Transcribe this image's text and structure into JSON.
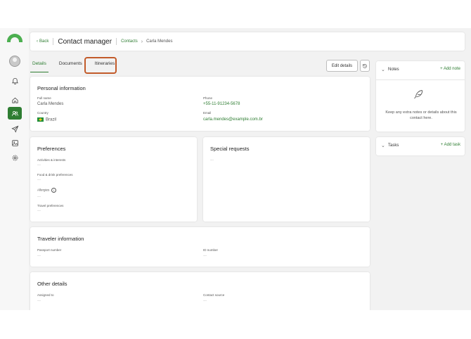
{
  "header": {
    "back_label": "Back",
    "title": "Contact manager",
    "breadcrumb_parent": "Contacts",
    "breadcrumb_current": "Carla Mendes"
  },
  "tabs": [
    {
      "label": "Details",
      "active": true
    },
    {
      "label": "Documents",
      "active": false
    },
    {
      "label": "Itineraries",
      "active": false
    }
  ],
  "toolbar": {
    "edit_label": "Edit details"
  },
  "personal": {
    "title": "Personal information",
    "full_name_label": "Full name",
    "full_name_value": "Carla Mendes",
    "phone_label": "Phone",
    "phone_value": "+55-11-91234-5678",
    "country_label": "Country",
    "country_value": "Brazil",
    "email_label": "Email",
    "email_value": "carla.mendes@example.com.br"
  },
  "preferences": {
    "title": "Preferences",
    "activities_label": "Activities & interests",
    "food_label": "Food & drink preferences",
    "allergies_label": "Allergies",
    "travel_label": "Travel preferences",
    "empty": "---"
  },
  "special_requests": {
    "title": "Special requests",
    "empty": "---"
  },
  "traveler": {
    "title": "Traveler information",
    "passport_label": "Passport number",
    "id_label": "ID number",
    "empty": "---"
  },
  "other": {
    "title": "Other details",
    "assigned_label": "Assigned to",
    "source_label": "Contact source",
    "empty": "---"
  },
  "notes": {
    "title": "Notes",
    "add_label": "Add note",
    "empty_text": "Keep any extra notes or details about this contact here."
  },
  "tasks": {
    "title": "Tasks",
    "add_label": "Add task"
  },
  "colors": {
    "accent": "#2e7d32",
    "logo": "#4caf50",
    "highlight": "#c25b2a"
  },
  "icons": [
    "home-icon",
    "contacts-icon",
    "send-icon",
    "image-icon",
    "gear-icon",
    "bell-icon",
    "history-icon",
    "feather-icon",
    "info-icon"
  ]
}
